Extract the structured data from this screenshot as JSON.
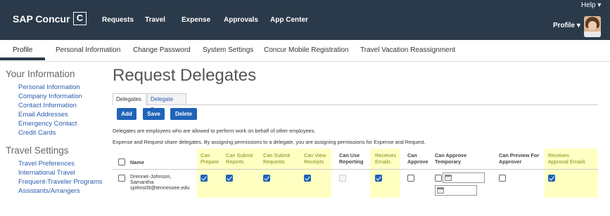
{
  "topbar": {
    "logo": "SAP Concur",
    "logo_mark": "C",
    "nav": [
      "Requests",
      "Travel",
      "Expense",
      "Approvals",
      "App Center"
    ],
    "help": "Help ▾",
    "profile": "Profile ▾"
  },
  "subnav": [
    "Profile",
    "Personal Information",
    "Change Password",
    "System Settings",
    "Concur Mobile Registration",
    "Travel Vacation Reassignment"
  ],
  "sidebar": {
    "your_info_title": "Your Information",
    "your_info_links": [
      "Personal Information",
      "Company Information",
      "Contact Information",
      "Email Addresses",
      "Emergency Contact",
      "Credit Cards"
    ],
    "travel_title": "Travel Settings",
    "travel_links": [
      "Travel Preferences",
      "International Travel",
      "Frequent-Traveler Programs",
      "Assistants/Arrangers"
    ]
  },
  "main": {
    "title": "Request Delegates",
    "tabs": [
      "Delegates",
      "Delegate For"
    ],
    "buttons": [
      "Add",
      "Save",
      "Delete"
    ],
    "desc1": "Delegates are employees who are allowed to perform work on behalf of other employees.",
    "desc2": "Expense and Request share delegates. By assigning permissions to a delegate, you are assigning permissions for Expense and Request."
  },
  "table": {
    "headers": {
      "name": "Name",
      "can_prepare": [
        "Can",
        "Prepare"
      ],
      "can_submit_reports": [
        "Can Submit",
        "Reports"
      ],
      "can_submit_requests": [
        "Can Submit",
        "Requests"
      ],
      "can_view_receipts": [
        "Can View",
        "Receipts"
      ],
      "can_use_reporting": [
        "Can Use",
        "Reporting"
      ],
      "receives_emails": [
        "Receives",
        "Emails"
      ],
      "can_approve": [
        "Can",
        "Approve"
      ],
      "can_approve_temporary": [
        "Can Approve",
        "Temporary"
      ],
      "can_preview_for_approver": [
        "Can Preview For",
        "Approver"
      ],
      "receives_approval_emails": [
        "Receives",
        "Approval Emails"
      ]
    },
    "row": {
      "name": [
        "Drenner-Johnson,",
        "Samantha",
        "sjohns09@tennessee.edu"
      ],
      "can_prepare": true,
      "can_submit_reports": true,
      "can_submit_requests": true,
      "can_view_receipts": true,
      "can_use_reporting": false,
      "receives_emails": true,
      "can_approve": false,
      "can_approve_temporary": false,
      "can_preview_for_approver": false,
      "receives_approval_emails": true
    }
  },
  "colors": {
    "topbar": "#2b3a4a",
    "accent": "#1f64b8",
    "highlight": "#ffffc2",
    "header_green": "#7a8b18",
    "link": "#2a5db0"
  }
}
